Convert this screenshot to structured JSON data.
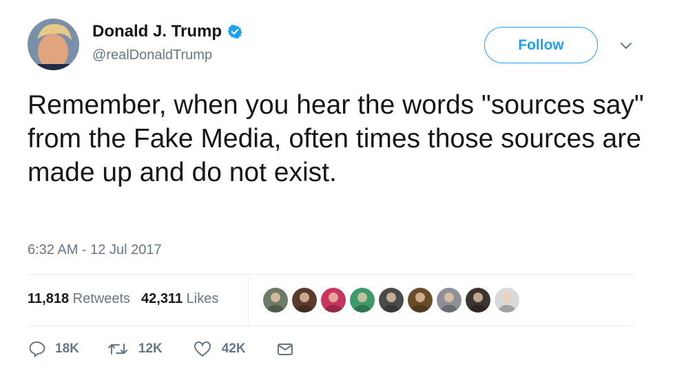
{
  "author": {
    "display_name": "Donald J. Trump",
    "handle": "@realDonaldTrump",
    "verified": true,
    "avatar_icon": "profile-photo"
  },
  "follow_button": {
    "label": "Follow"
  },
  "menu": {
    "icon": "chevron-down-icon"
  },
  "tweet": {
    "text": "Remember, when you hear the words \"sources say\" from the Fake Media, often times those sources are made up and do not exist.",
    "timestamp": "6:32 AM - 12 Jul 2017"
  },
  "stats": {
    "retweets_count": "11,818",
    "retweets_label": "Retweets",
    "likes_count": "42,311",
    "likes_label": "Likes"
  },
  "likers": [
    {
      "icon": "liker-avatar-1",
      "color": "#6d7a66"
    },
    {
      "icon": "liker-avatar-2",
      "color": "#5a3a2c"
    },
    {
      "icon": "liker-avatar-3",
      "color": "#c7365f"
    },
    {
      "icon": "liker-avatar-4",
      "color": "#3f9a6b"
    },
    {
      "icon": "liker-avatar-5",
      "color": "#4a4a4a"
    },
    {
      "icon": "liker-avatar-6",
      "color": "#6b4c2a"
    },
    {
      "icon": "liker-avatar-7",
      "color": "#8d9096"
    },
    {
      "icon": "liker-avatar-8",
      "color": "#3b3431"
    },
    {
      "icon": "liker-avatar-9",
      "color": "#d9d9d9"
    }
  ],
  "actions": {
    "reply_count": "18K",
    "retweet_count": "12K",
    "like_count": "42K"
  },
  "colors": {
    "accent": "#1da1f2",
    "secondary_text": "#657786",
    "divider": "#e6ecf0"
  }
}
